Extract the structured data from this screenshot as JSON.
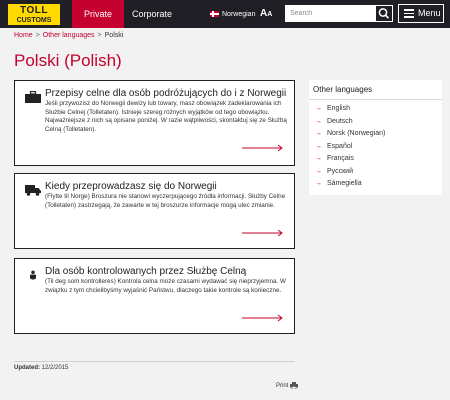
{
  "header": {
    "logo_line1": "TOLL",
    "logo_line2": "CUSTOMS",
    "tabs": [
      {
        "label": "Private",
        "active": true
      },
      {
        "label": "Corporate",
        "active": false
      }
    ],
    "language_label": "Norwegian",
    "text_size_icon": "text-size-icon",
    "search_placeholder": "Search",
    "menu_label": "Menu"
  },
  "breadcrumb": [
    "Home",
    "Other languages",
    "Polski"
  ],
  "page_title": "Polski (Polish)",
  "cards": [
    {
      "icon": "briefcase-icon",
      "title": "Przepisy celne dla osób podróżujących do i z Norwegii",
      "text": "Jeśli przywozisz do Norwegii dewizy lub towary, masz obowiązek zadeklarowania ich Służbie Celnej (Tolletaten). Istnieje szereg różnych wyjątków od tego obowiązku. Najważniejsze z nich są opisane poniżej. W razie wątpliwości, skontaktuj się ze Służbą Celną (Tolletaten)."
    },
    {
      "icon": "truck-icon",
      "title": "Kiedy przeprowadzasz się do Norwegii",
      "text": "(Flytte til Norge) Broszura nie stanowi wyczerpującego źródła informacji. Służby Celne (Tolletaten) zastrzegają, że zawarte w tej broszurze informacje mogą ulec zmianie."
    },
    {
      "icon": "person-icon",
      "title": "Dla osób kontrolowanych przez Służbę Celną",
      "text": "(Til deg som kontrolleres) Kontrola celna może czasami wydawać się nieprzyjemna. W związku z tym chcielibyśmy wyjaśnić Państwu, dlaczego takie kontrole są konieczne."
    }
  ],
  "updated_label": "Updated:",
  "updated_date": "12/2/2015",
  "print_label": "Print",
  "sidebar": {
    "title": "Other languages",
    "items": [
      "English",
      "Deutsch",
      "Norsk (Norwegian)",
      "Español",
      "Français",
      "Русский",
      "Sámegiella"
    ]
  },
  "colors": {
    "brand_red": "#c4012f",
    "header_dark": "#1f1f25",
    "logo_yellow": "#ffd900"
  }
}
